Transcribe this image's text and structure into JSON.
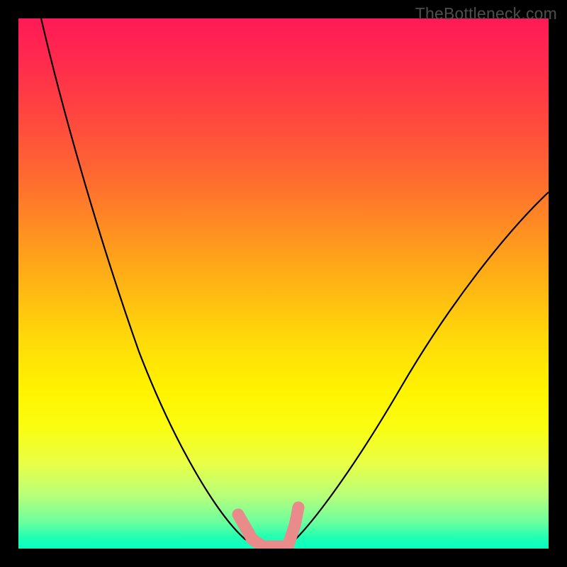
{
  "watermark": "TheBottleneck.com",
  "chart_data": {
    "type": "line",
    "title": "",
    "xlabel": "",
    "ylabel": "",
    "ylim": [
      0,
      100
    ],
    "series": [
      {
        "name": "left-curve",
        "x": [
          0.0,
          0.05,
          0.1,
          0.15,
          0.2,
          0.25,
          0.3,
          0.35,
          0.4,
          0.44,
          0.46
        ],
        "values": [
          100,
          85,
          70,
          56,
          42,
          30,
          20,
          12,
          6,
          2,
          0
        ]
      },
      {
        "name": "right-curve",
        "x": [
          0.5,
          0.55,
          0.6,
          0.65,
          0.7,
          0.75,
          0.8,
          0.85,
          0.9,
          0.95,
          1.0
        ],
        "values": [
          0,
          4,
          10,
          17,
          25,
          33,
          41,
          49,
          56,
          62,
          67
        ]
      },
      {
        "name": "pink-marker",
        "x": [
          0.42,
          0.44,
          0.47,
          0.5,
          0.51,
          0.515
        ],
        "values": [
          6,
          2,
          0,
          0,
          4,
          8
        ]
      }
    ]
  },
  "colors": {
    "curve": "#000000",
    "marker": "#e98b8b"
  }
}
